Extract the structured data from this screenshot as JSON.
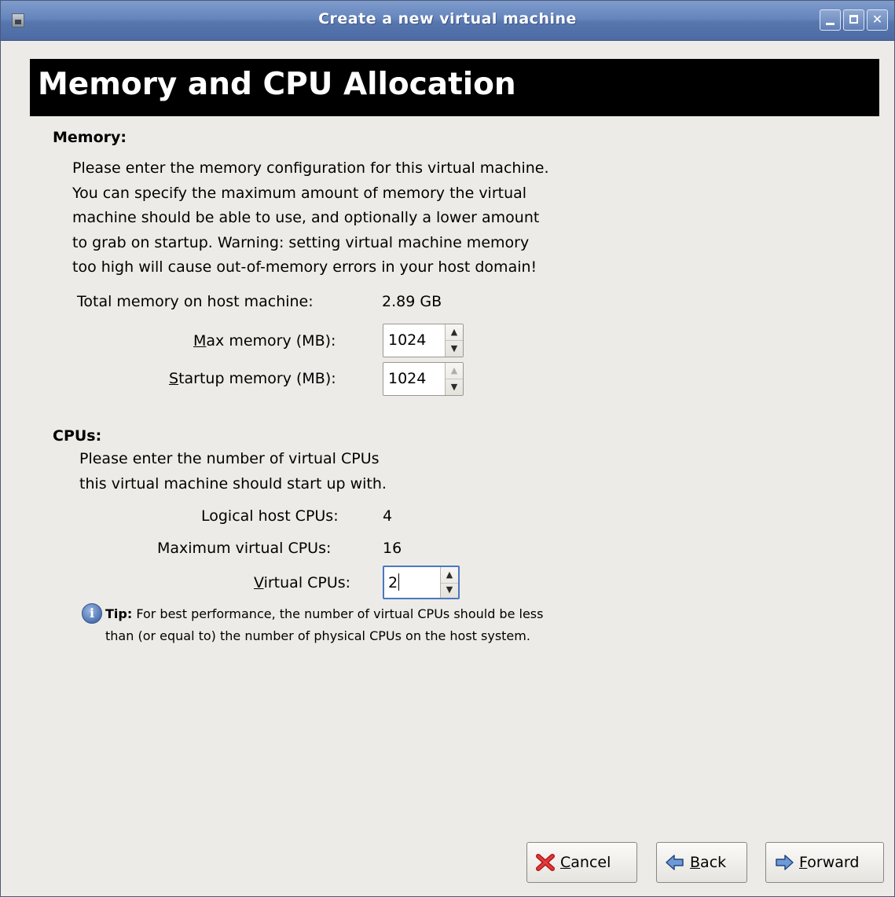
{
  "window": {
    "title": "Create a new virtual machine"
  },
  "header": {
    "title": "Memory and CPU Allocation"
  },
  "memory": {
    "section_title": "Memory:",
    "description_lines": [
      "Please enter the memory configuration for this virtual machine.",
      "You can specify the maximum amount of memory the virtual",
      "machine should be able to use, and optionally a lower amount",
      "to grab on startup. Warning: setting virtual machine memory",
      "too high will cause out-of-memory errors in your host domain!"
    ],
    "total_label": "Total memory on host machine:",
    "total_value": "2.89 GB",
    "max_label_mnemonic": "M",
    "max_label_rest": "ax memory (MB):",
    "max_value": "1024",
    "startup_label_mnemonic": "S",
    "startup_label_rest": "tartup memory (MB):",
    "startup_value": "1024"
  },
  "cpus": {
    "section_title": "CPUs:",
    "description_lines": [
      "Please enter the number of virtual CPUs",
      "this virtual machine should start up with."
    ],
    "logical_label": "Logical host CPUs:",
    "logical_value": "4",
    "max_label": "Maximum virtual CPUs:",
    "max_value": "16",
    "vcpu_label_mnemonic": "V",
    "vcpu_label_rest": "irtual CPUs:",
    "vcpu_value": "2"
  },
  "tip": {
    "bold": "Tip:",
    "line1": " For best performance, the number of virtual CPUs should be less",
    "line2": "than (or equal to) the number of physical CPUs on the host system."
  },
  "buttons": {
    "cancel_mnemonic": "C",
    "cancel_rest": "ancel",
    "back_mnemonic": "B",
    "back_rest": "ack",
    "forward_mnemonic": "F",
    "forward_rest": "orward"
  },
  "colors": {
    "titlebar": "#5f7fb6",
    "window_bg": "#edebe7",
    "banner_bg": "#000000",
    "focus": "#4a78c2"
  },
  "icons": {
    "window": "app-window-icon",
    "tip": "info-icon",
    "cancel": "red-x-icon",
    "back": "arrow-left-icon",
    "forward": "arrow-right-icon"
  }
}
